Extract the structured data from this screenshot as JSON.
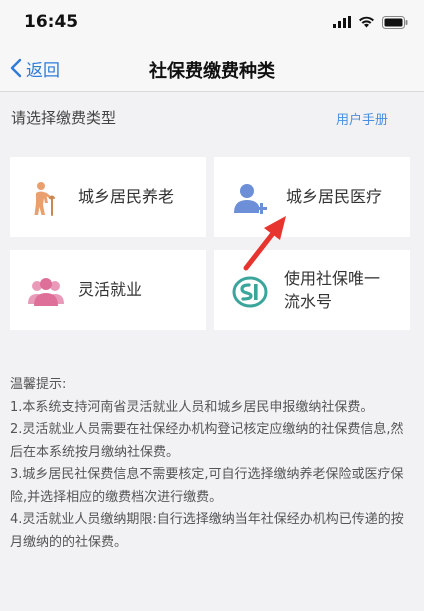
{
  "status_bar": {
    "time": "16:45"
  },
  "nav": {
    "back_label": "返回",
    "title": "社保费缴费种类"
  },
  "section": {
    "title": "请选择缴费类型",
    "manual_link": "用户手册"
  },
  "cards": [
    {
      "label": "城乡居民养老",
      "icon": "elderly-person-icon",
      "color": "#e9a06e"
    },
    {
      "label": "城乡居民医疗",
      "icon": "add-user-icon",
      "color": "#6c8fd8"
    },
    {
      "label": "灵活就业",
      "icon": "people-group-icon",
      "color": "#e27fa4"
    },
    {
      "label": "使用社保唯一流水号",
      "icon": "si-logo-icon",
      "color": "#3aa59b"
    }
  ],
  "tips": {
    "title": "温馨提示:",
    "items": [
      "1.本系统支持河南省灵活就业人员和城乡居民申报缴纳社保费。",
      "2.灵活就业人员需要在社保经办机构登记核定应缴纳的社保费信息,然后在本系统按月缴纳社保费。",
      "3.城乡居民社保费信息不需要核定,可自行选择缴纳养老保险或医疗保险,并选择相应的缴费档次进行缴费。",
      "4.灵活就业人员缴纳期限:自行选择缴纳当年社保经办机构已传递的按月缴纳的的社保费。"
    ]
  },
  "colors": {
    "accent": "#2f7bd9",
    "arrow": "#e8342f"
  }
}
